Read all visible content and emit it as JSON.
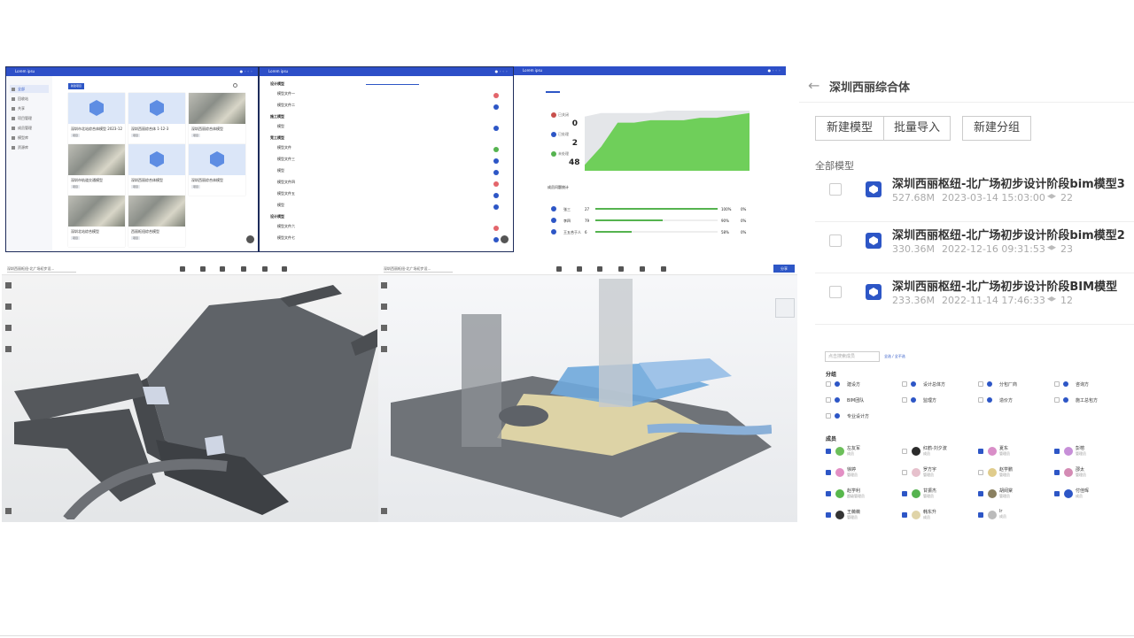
{
  "panel1": {
    "app_title": "Lorem ipsu",
    "sidebar": [
      "全部",
      "回收站",
      "共享",
      "项目管理",
      "成员管理",
      "模型库",
      "资源库"
    ],
    "new_button": "新建项目",
    "cards": [
      {
        "name": "深圳市北站综合体模型 2023-12",
        "tag": "项目"
      },
      {
        "name": "深圳西丽综合体 1-12-3",
        "tag": "项目"
      },
      {
        "name": "深圳西丽综合体模型",
        "tag": "项目"
      },
      {
        "name": "深圳市轨道交通模型",
        "tag": "项目"
      },
      {
        "name": "深圳西丽综合体模型",
        "tag": "项目"
      },
      {
        "name": "深圳西丽综合体模型",
        "tag": "项目"
      },
      {
        "name": "深圳北站综合模型",
        "tag": "项目"
      },
      {
        "name": "西丽枢纽综合模型",
        "tag": "项目"
      }
    ]
  },
  "panel2": {
    "app_title": "Lorem ipsu",
    "groups": [
      "设计模型",
      "施工模型",
      "竞工模型"
    ],
    "rows": [
      "模型文件一",
      "模型文件二",
      "模型",
      "模型文件",
      "模型文件三",
      "模型",
      "模型文件四",
      "模型文件五",
      "模型",
      "模型文件六",
      "模型文件七"
    ]
  },
  "panel3": {
    "app_title": "Lorem ipsu",
    "stats": [
      {
        "label": "已关闭",
        "value": "0"
      },
      {
        "label": "已处理",
        "value": "2"
      },
      {
        "label": "未处理",
        "value": "48"
      }
    ],
    "chart_data": {
      "type": "area",
      "series": [
        {
          "values": [
            5,
            20,
            40,
            40,
            42,
            42,
            42,
            44,
            44,
            46,
            48
          ]
        },
        {
          "values": [
            45,
            48,
            48,
            48,
            48,
            50,
            50,
            50,
            50,
            50,
            50
          ]
        }
      ],
      "x": [
        1,
        2,
        3,
        4,
        5,
        6,
        7,
        8,
        9,
        10,
        11
      ],
      "ylim": [
        0,
        50
      ],
      "grid": false
    },
    "table_title": "成员问题统计",
    "table_rows": [
      {
        "name": "张三",
        "count": "27",
        "pct": "100%",
        "rate": "0%",
        "fill": 1.0
      },
      {
        "name": "李四",
        "count": "79",
        "pct": "90%",
        "rate": "0%",
        "fill": 0.55
      },
      {
        "name": "王五合于人",
        "count": "6",
        "pct": "58%",
        "rate": "0%",
        "fill": 0.3
      }
    ]
  },
  "viewer_left": {
    "selector": "深圳西丽枢纽-北广场初步设..."
  },
  "viewer_right": {
    "selector": "深圳西丽枢纽-北广场初步设...",
    "share_button": "分享"
  },
  "detail": {
    "title": "深圳西丽综合体",
    "buttons": [
      "新建模型",
      "批量导入",
      "新建分组"
    ],
    "section_label": "全部模型",
    "models": [
      {
        "name": "深圳西丽枢纽-北广场初步设计阶段bim模型3",
        "size": "527.68M",
        "date": "2023-03-14 15:03:00",
        "count": "22"
      },
      {
        "name": "深圳西丽枢纽-北广场初步设计阶段bim模型2",
        "size": "330.36M",
        "date": "2022-12-16 09:31:53",
        "count": "23"
      },
      {
        "name": "深圳西丽枢纽-北广场初步设计阶段BIM模型",
        "size": "233.36M",
        "date": "2022-11-14 17:46:33",
        "count": "12"
      }
    ]
  },
  "members": {
    "search_placeholder": "点击搜索成员",
    "select_all": "全选 / 全不选",
    "group_title": "分组",
    "groups": [
      "建设方",
      "设计总体方",
      "分包厂商",
      "咨询方",
      "BIM团队",
      "监理方",
      "造价方",
      "施工总包方",
      "专业设计方"
    ],
    "member_title": "成员",
    "list": [
      {
        "name": "左友军",
        "role": "成员",
        "checked": true,
        "color": "#6cbf5a"
      },
      {
        "name": "红鹤-刘夕波",
        "role": "成员",
        "checked": false,
        "color": "#2b2b2b"
      },
      {
        "name": "夏东",
        "role": "管理员",
        "checked": true,
        "color": "#d98ec8"
      },
      {
        "name": "彭榕",
        "role": "管理员",
        "checked": true,
        "color": "#c78fd8"
      },
      {
        "name": "徐婷",
        "role": "管理员",
        "checked": true,
        "color": "#e38fc4"
      },
      {
        "name": "罗方宇",
        "role": "管理员",
        "checked": false,
        "color": "#e6c0cc"
      },
      {
        "name": "赵学鹏",
        "role": "管理员",
        "checked": false,
        "color": "#e0cc8c"
      },
      {
        "name": "邵太",
        "role": "管理员",
        "checked": true,
        "color": "#d48bb4"
      },
      {
        "name": "赵学利",
        "role": "超级管理员",
        "checked": true,
        "color": "#58b84c"
      },
      {
        "name": "甘振杰",
        "role": "管理员",
        "checked": true,
        "color": "#55b34f"
      },
      {
        "name": "胡阏棠",
        "role": "管理员",
        "checked": true,
        "color": "#8a8060"
      },
      {
        "name": "付佳晖",
        "role": "成员",
        "checked": true,
        "color": "#2d56c6"
      },
      {
        "name": "王薇薇",
        "role": "管理员",
        "checked": true,
        "color": "#333333"
      },
      {
        "name": "韩东升",
        "role": "成员",
        "checked": true,
        "color": "#e0d4a8"
      },
      {
        "name": "lr",
        "role": "成员",
        "checked": true,
        "color": "#bbbbbb"
      }
    ]
  }
}
